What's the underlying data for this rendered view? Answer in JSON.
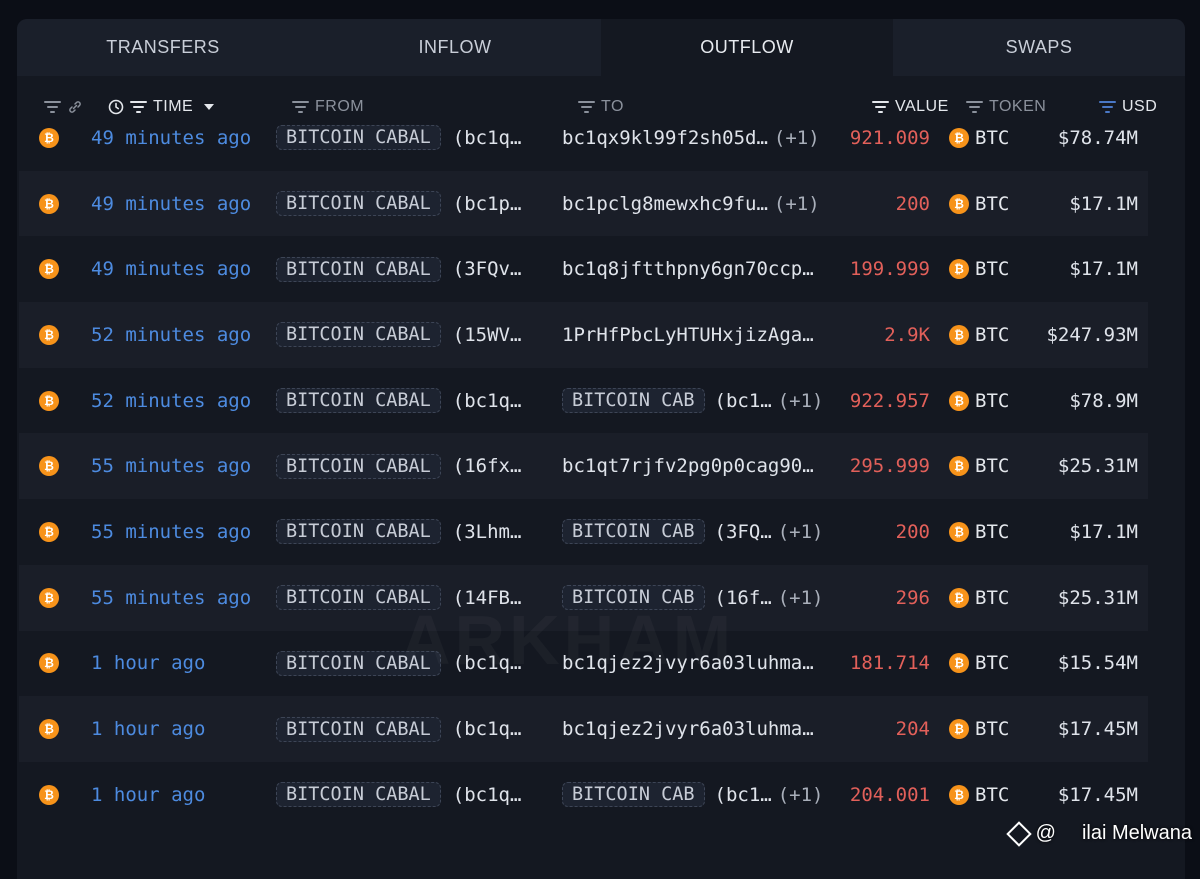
{
  "tabs": [
    {
      "label": "TRANSFERS",
      "active": false
    },
    {
      "label": "INFLOW",
      "active": false
    },
    {
      "label": "OUTFLOW",
      "active": true
    },
    {
      "label": "SWAPS",
      "active": false
    }
  ],
  "columns": {
    "time": "TIME",
    "from": "FROM",
    "to": "TO",
    "value": "VALUE",
    "token": "TOKEN",
    "usd": "USD"
  },
  "icons": {
    "coin": "bitcoin-icon",
    "coin_glyph": "₿",
    "clock": "clock-icon",
    "link": "link-icon",
    "filter": "filter-icon",
    "sort": "sort-desc-icon"
  },
  "colors": {
    "time": "#4d8be0",
    "value": "#e2605a",
    "coin": "#f7931a"
  },
  "rows": [
    {
      "time": "49 minutes ago",
      "from_tag": "BITCOIN CABAL",
      "from_addr": "(bc1q…",
      "to_tag": "",
      "to_addr": "bc1qx9kl99f2sh05d…",
      "to_extra": "(+1)",
      "value": "921.009",
      "token": "BTC",
      "usd": "$78.74M"
    },
    {
      "time": "49 minutes ago",
      "from_tag": "BITCOIN CABAL",
      "from_addr": "(bc1p…",
      "to_tag": "",
      "to_addr": "bc1pclg8mewxhc9fu…",
      "to_extra": "(+1)",
      "value": "200",
      "token": "BTC",
      "usd": "$17.1M"
    },
    {
      "time": "49 minutes ago",
      "from_tag": "BITCOIN CABAL",
      "from_addr": "(3FQv…",
      "to_tag": "",
      "to_addr": "bc1q8jftthpny6gn70ccp…",
      "to_extra": "",
      "value": "199.999",
      "token": "BTC",
      "usd": "$17.1M"
    },
    {
      "time": "52 minutes ago",
      "from_tag": "BITCOIN CABAL",
      "from_addr": "(15WV…",
      "to_tag": "",
      "to_addr": "1PrHfPbcLyHTUHxjizAga…",
      "to_extra": "",
      "value": "2.9K",
      "token": "BTC",
      "usd": "$247.93M"
    },
    {
      "time": "52 minutes ago",
      "from_tag": "BITCOIN CABAL",
      "from_addr": "(bc1q…",
      "to_tag": "BITCOIN CAB",
      "to_addr": "(bc1…",
      "to_extra": "(+1)",
      "value": "922.957",
      "token": "BTC",
      "usd": "$78.9M"
    },
    {
      "time": "55 minutes ago",
      "from_tag": "BITCOIN CABAL",
      "from_addr": "(16fx…",
      "to_tag": "",
      "to_addr": "bc1qt7rjfv2pg0p0cag90…",
      "to_extra": "",
      "value": "295.999",
      "token": "BTC",
      "usd": "$25.31M"
    },
    {
      "time": "55 minutes ago",
      "from_tag": "BITCOIN CABAL",
      "from_addr": "(3Lhm…",
      "to_tag": "BITCOIN CAB",
      "to_addr": "(3FQ…",
      "to_extra": "(+1)",
      "value": "200",
      "token": "BTC",
      "usd": "$17.1M"
    },
    {
      "time": "55 minutes ago",
      "from_tag": "BITCOIN CABAL",
      "from_addr": "(14FB…",
      "to_tag": "BITCOIN CAB",
      "to_addr": "(16f…",
      "to_extra": "(+1)",
      "value": "296",
      "token": "BTC",
      "usd": "$25.31M"
    },
    {
      "time": "1 hour ago",
      "from_tag": "BITCOIN CABAL",
      "from_addr": "(bc1q…",
      "to_tag": "",
      "to_addr": "bc1qjez2jvyr6a03luhma…",
      "to_extra": "",
      "value": "181.714",
      "token": "BTC",
      "usd": "$15.54M"
    },
    {
      "time": "1 hour ago",
      "from_tag": "BITCOIN CABAL",
      "from_addr": "(bc1q…",
      "to_tag": "",
      "to_addr": "bc1qjez2jvyr6a03luhma…",
      "to_extra": "",
      "value": "204",
      "token": "BTC",
      "usd": "$17.45M"
    },
    {
      "time": "1 hour ago",
      "from_tag": "BITCOIN CABAL",
      "from_addr": "(bc1q…",
      "to_tag": "BITCOIN CAB",
      "to_addr": "(bc1…",
      "to_extra": "(+1)",
      "value": "204.001",
      "token": "BTC",
      "usd": "$17.45M"
    }
  ],
  "watermark": "ARKHAM",
  "credit": {
    "at": "@",
    "name": "ilai Melwana"
  }
}
